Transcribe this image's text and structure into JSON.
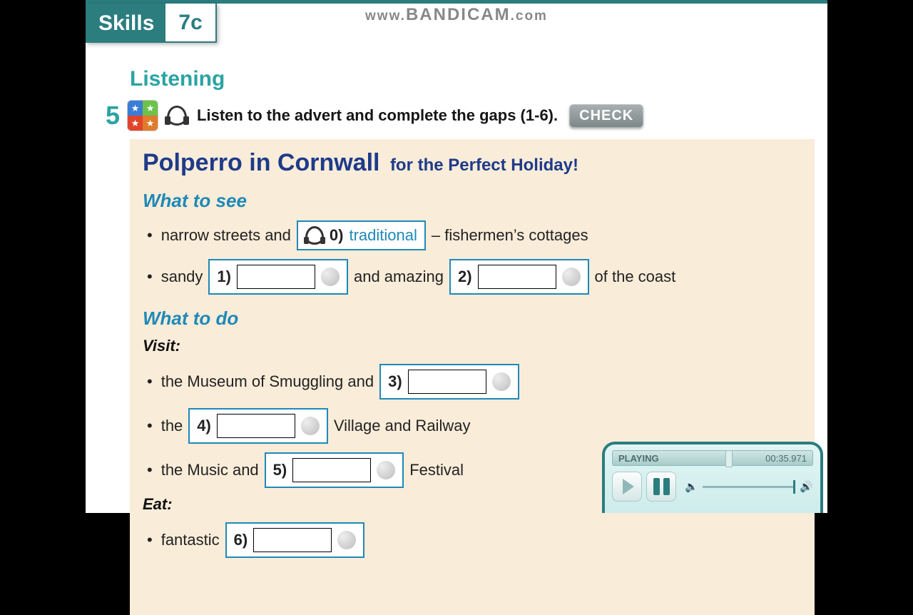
{
  "watermark": {
    "prefix": "www.",
    "brand": "BANDICAM",
    "suffix": ".com"
  },
  "tab": {
    "label_a": "Skills",
    "label_b": "7c"
  },
  "section": {
    "title": "Listening"
  },
  "exercise": {
    "number": "5",
    "instruction": "Listen to the advert and complete the gaps (1-6).",
    "check_label": "CHECK"
  },
  "worksheet": {
    "title_main": "Polperro in Cornwall",
    "title_sub": "for the Perfect Holiday!",
    "see_heading": "What to see",
    "see_line1_a": "narrow streets and",
    "gap0_num": "0)",
    "gap0_answer": "traditional",
    "see_line1_b": "– fishermen’s cottages",
    "see_line2_a": "sandy",
    "gap1_num": "1)",
    "see_line2_b": "and amazing",
    "gap2_num": "2)",
    "see_line2_c": "of the coast",
    "do_heading": "What to do",
    "visit_heading": "Visit:",
    "do_line1_a": "the Museum of Smuggling and",
    "gap3_num": "3)",
    "do_line2_a": "the",
    "gap4_num": "4)",
    "do_line2_b": "Village and Railway",
    "do_line3_a": "the Music and",
    "gap5_num": "5)",
    "do_line3_b": "Festival",
    "eat_heading": "Eat:",
    "eat_line1_a": "fantastic",
    "gap6_num": "6)"
  },
  "player": {
    "status": "PLAYING",
    "time": "00:35.971"
  }
}
